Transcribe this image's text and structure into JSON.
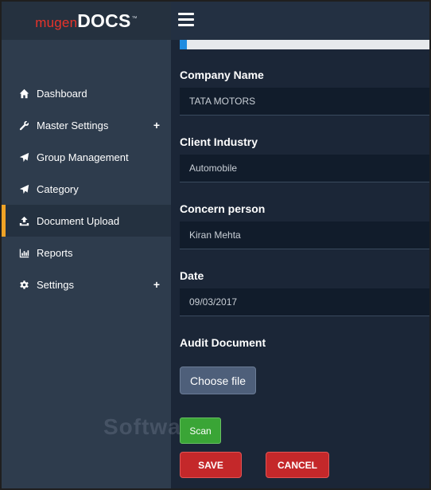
{
  "logo": {
    "light": "mugen",
    "bold": "DOCS",
    "tm": "™"
  },
  "sidebar": {
    "items": [
      {
        "label": "Dashboard",
        "icon": "home-icon",
        "expandable": false,
        "active": false
      },
      {
        "label": "Master Settings",
        "icon": "wrench-icon",
        "expandable": true,
        "active": false
      },
      {
        "label": "Group Management",
        "icon": "paper-plane-icon",
        "expandable": false,
        "active": false
      },
      {
        "label": "Category",
        "icon": "paper-plane-icon",
        "expandable": false,
        "active": false
      },
      {
        "label": "Document Upload",
        "icon": "upload-icon",
        "expandable": false,
        "active": true
      },
      {
        "label": "Reports",
        "icon": "bar-chart-icon",
        "expandable": false,
        "active": false
      },
      {
        "label": "Settings",
        "icon": "gear-icon",
        "expandable": true,
        "active": false
      }
    ],
    "plus_symbol": "+"
  },
  "progress": {
    "fraction": 0.03
  },
  "form": {
    "company_name": {
      "label": "Company Name",
      "value": "TATA MOTORS"
    },
    "client_industry": {
      "label": "Client Industry",
      "value": "Automobile"
    },
    "concern_person": {
      "label": "Concern person",
      "value": "Kiran Mehta"
    },
    "date": {
      "label": "Date",
      "value": "09/03/2017"
    },
    "audit_document": {
      "label": "Audit Document"
    }
  },
  "buttons": {
    "choose_file": "Choose file",
    "scan": "Scan",
    "save": "SAVE",
    "cancel": "CANCEL"
  },
  "colors": {
    "accent": "#f0a326",
    "sidebar": "#2e3c4d",
    "content_bg": "#1b2637",
    "danger": "#c4282a",
    "success": "#3aa536"
  }
}
